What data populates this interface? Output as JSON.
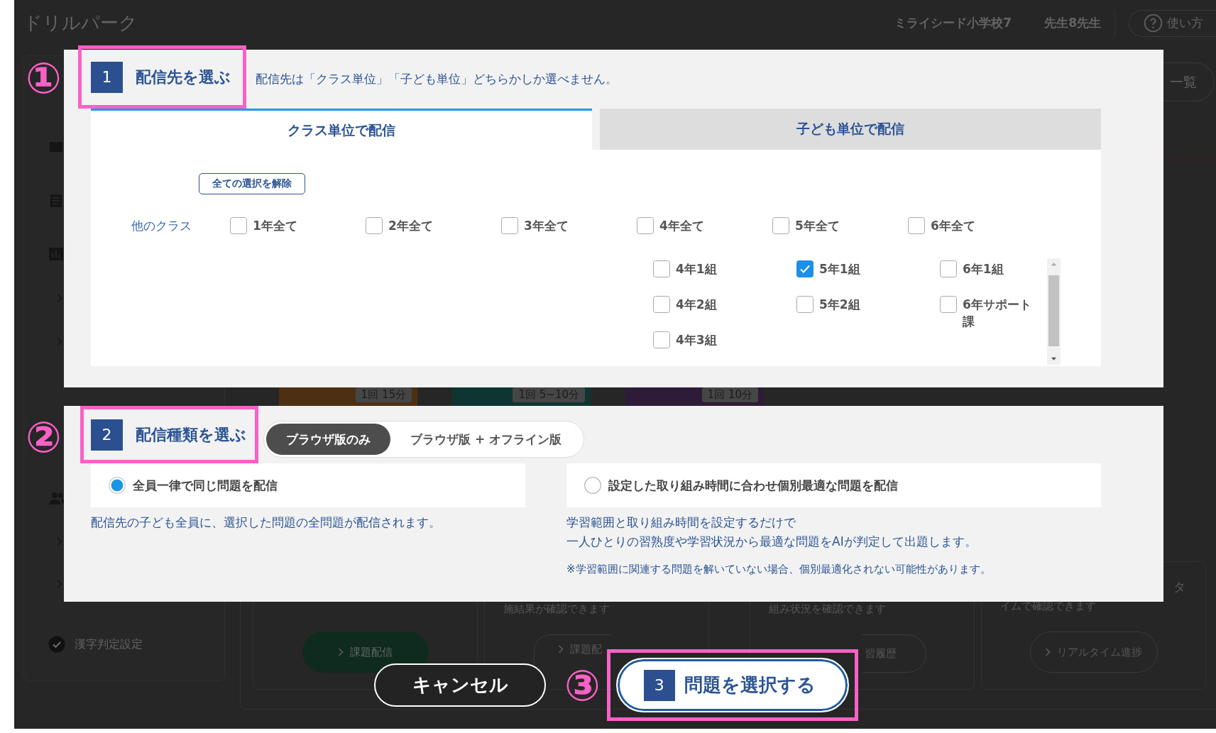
{
  "background": {
    "header": {
      "logo": "ドリルパーク",
      "school": "ミライシード小学校7",
      "teacher": "先生8先生",
      "help_button": "使い方"
    },
    "list_button": "一覧",
    "sidebar": {
      "bottom_item": "漢字判定設定"
    },
    "thumbnails": [
      {
        "duration": "1回 15分",
        "color": "#4d2f12"
      },
      {
        "duration": "1回 5~10分",
        "color": "#0f3533"
      },
      {
        "duration": "1回 10分",
        "color": "#2d1b38"
      }
    ],
    "cards": [
      {
        "button": "課題配信",
        "kind": "filled",
        "chevron": true
      },
      {
        "description": "施結果が確認できます",
        "button": "課題配",
        "kind": "cut-right",
        "chevron": true
      },
      {
        "description": "組み状況を確認できます",
        "button": "習履歴",
        "kind": "cut-left",
        "chevron": false
      },
      {
        "title": "タ",
        "description": "イムで確認できます",
        "button": "リアルタイム進捗",
        "kind": "outline",
        "chevron": true
      }
    ]
  },
  "step1": {
    "marker": "①",
    "number": "1",
    "title": "配信先を選ぶ",
    "note": "配信先は「クラス単位」「子ども単位」どちらかしか選べません。",
    "tabs": [
      {
        "label": "クラス単位で配信",
        "selected": true
      },
      {
        "label": "子ども単位で配信",
        "selected": false
      }
    ],
    "clear_button": "全ての選択を解除",
    "other_classes": {
      "label": "他のクラス",
      "grades": [
        {
          "label": "1年全て",
          "checked": false
        },
        {
          "label": "2年全て",
          "checked": false
        },
        {
          "label": "3年全て",
          "checked": false
        },
        {
          "label": "4年全て",
          "checked": false
        },
        {
          "label": "5年全て",
          "checked": false
        },
        {
          "label": "6年全て",
          "checked": false
        }
      ]
    },
    "class_columns": [
      {
        "classes": [
          {
            "label": "4年1組",
            "checked": false
          },
          {
            "label": "4年2組",
            "checked": false
          },
          {
            "label": "4年3組",
            "checked": false
          }
        ]
      },
      {
        "classes": [
          {
            "label": "5年1組",
            "checked": true
          },
          {
            "label": "5年2組",
            "checked": false
          }
        ]
      },
      {
        "classes": [
          {
            "label": "6年1組",
            "checked": false
          },
          {
            "label": "6年サポート課",
            "checked": false
          }
        ]
      }
    ]
  },
  "step2": {
    "marker": "②",
    "number": "2",
    "title": "配信種類を選ぶ",
    "versions": [
      {
        "label": "ブラウザ版のみ",
        "selected": true
      },
      {
        "label": "ブラウザ版 + オフライン版",
        "selected": false
      }
    ],
    "options": [
      {
        "label": "全員一律で同じ問題を配信",
        "selected": true,
        "description": [
          "配信先の子ども全員に、選択した問題の全問題が配信されます。"
        ]
      },
      {
        "label": "設定した取り組み時間に合わせ個別最適な問題を配信",
        "selected": false,
        "description": [
          "学習範囲と取り組み時間を設定するだけで",
          "一人ひとりの習熟度や学習状況から最適な問題をAIが判定して出題します。"
        ],
        "note": "※学習範囲に関連する問題を解いていない場合、個別最適化されない可能性があります。"
      }
    ]
  },
  "footer": {
    "cancel_button": "キャンセル",
    "marker": "③",
    "confirm_number": "3",
    "confirm_button": "問題を選択する"
  }
}
